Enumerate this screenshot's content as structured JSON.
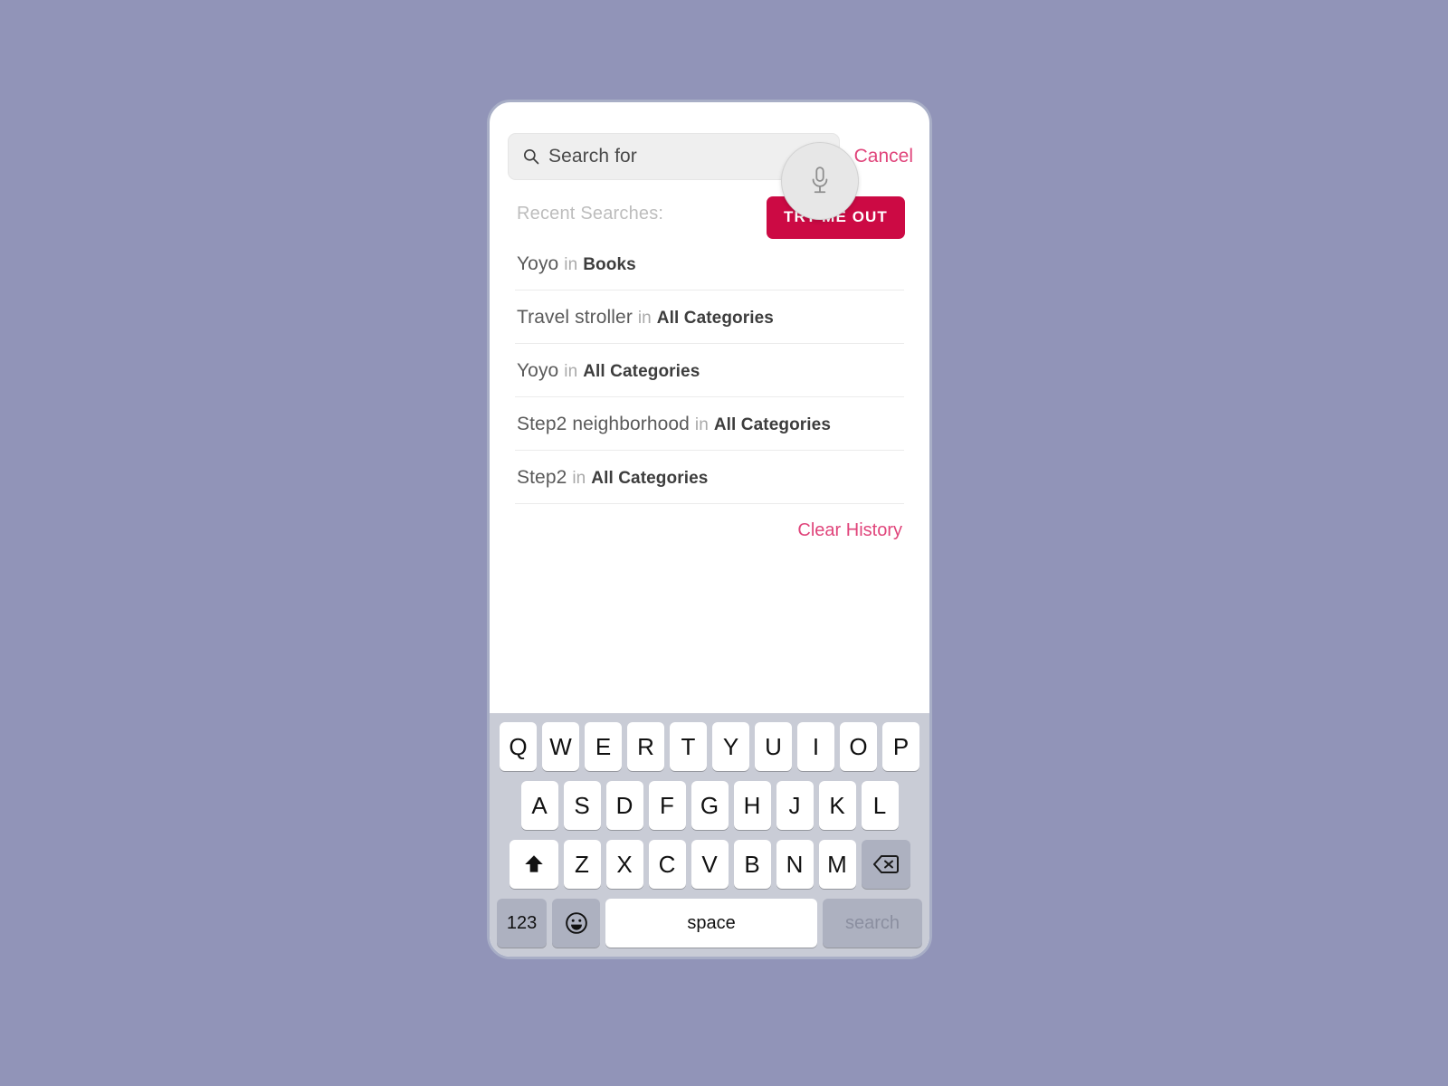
{
  "colors": {
    "background": "#9194B8",
    "accent_crimson": "#CC0A44",
    "accent_pink": "#E0457B",
    "search_field": "#EFEFEF",
    "keyboard_bg": "#C9CCD6",
    "key_dark": "#ADB1C0"
  },
  "search": {
    "placeholder": "Search for",
    "value": "",
    "magnifier_icon": "search-icon",
    "mic_icon": "microphone-icon",
    "cancel_label": "Cancel"
  },
  "tooltip": {
    "label": "TRY ME OUT"
  },
  "recent": {
    "heading": "Recent Searches:",
    "items": [
      {
        "query": "Yoyo",
        "connector": "in",
        "category": "Books"
      },
      {
        "query": "Travel stroller",
        "connector": "in",
        "category": "All Categories"
      },
      {
        "query": "Yoyo",
        "connector": "in",
        "category": "All Categories"
      },
      {
        "query": "Step2 neighborhood",
        "connector": "in",
        "category": "All Categories"
      },
      {
        "query": "Step2",
        "connector": "in",
        "category": "All Categories"
      }
    ],
    "clear_label": "Clear History"
  },
  "keyboard": {
    "row1": [
      "Q",
      "W",
      "E",
      "R",
      "T",
      "Y",
      "U",
      "I",
      "O",
      "P"
    ],
    "row2": [
      "A",
      "S",
      "D",
      "F",
      "G",
      "H",
      "J",
      "K",
      "L"
    ],
    "row3": [
      "Z",
      "X",
      "C",
      "V",
      "B",
      "N",
      "M"
    ],
    "shift_icon": "shift-up-arrow-icon",
    "backspace_icon": "backspace-delete-icon",
    "numbers_label": "123",
    "emoji_icon": "emoji-smiley-icon",
    "space_label": "space",
    "search_label": "search"
  }
}
